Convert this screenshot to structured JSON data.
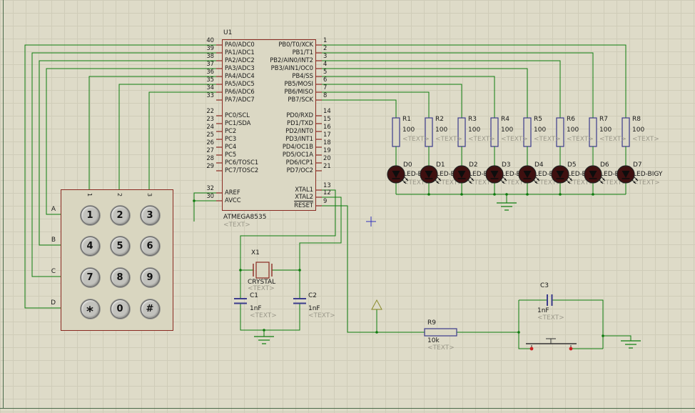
{
  "colors": {
    "background": "#dedbc8",
    "grid": "#cfccb8",
    "wire": "#0e7c0e",
    "component_outline": "#8a2a21",
    "analog_outline": "#3b3b8c",
    "component_fill": "#dbd8c4",
    "led_body": "#3f1010",
    "text_gray": "#9b988a",
    "origin_marker": "#3333bb",
    "button_dot": "#cc2222",
    "sheet_border": "#4a6a4a"
  },
  "chip": {
    "ref": "U1",
    "part": "ATMEGA8535",
    "text": "<TEXT>",
    "left_pins": [
      {
        "num": "40",
        "name": "PA0/ADC0"
      },
      {
        "num": "39",
        "name": "PA1/ADC1"
      },
      {
        "num": "38",
        "name": "PA2/ADC2"
      },
      {
        "num": "37",
        "name": "PA3/ADC3"
      },
      {
        "num": "36",
        "name": "PA4/ADC4"
      },
      {
        "num": "35",
        "name": "PA5/ADC5"
      },
      {
        "num": "34",
        "name": "PA6/ADC6"
      },
      {
        "num": "33",
        "name": "PA7/ADC7"
      },
      {
        "num": "22",
        "name": "PC0/SCL"
      },
      {
        "num": "23",
        "name": "PC1/SDA"
      },
      {
        "num": "24",
        "name": "PC2"
      },
      {
        "num": "25",
        "name": "PC3"
      },
      {
        "num": "26",
        "name": "PC4"
      },
      {
        "num": "27",
        "name": "PC5"
      },
      {
        "num": "28",
        "name": "PC6/TOSC1"
      },
      {
        "num": "29",
        "name": "PC7/TOSC2"
      },
      {
        "num": "32",
        "name": "AREF"
      },
      {
        "num": "30",
        "name": "AVCC"
      }
    ],
    "right_pins": [
      {
        "num": "1",
        "name": "PB0/T0/XCK"
      },
      {
        "num": "2",
        "name": "PB1/T1"
      },
      {
        "num": "3",
        "name": "PB2/AIN0/INT2"
      },
      {
        "num": "4",
        "name": "PB3/AIN1/OC0"
      },
      {
        "num": "5",
        "name": "PB4/SS"
      },
      {
        "num": "6",
        "name": "PB5/MOSI"
      },
      {
        "num": "7",
        "name": "PB6/MISO"
      },
      {
        "num": "8",
        "name": "PB7/SCK"
      },
      {
        "num": "14",
        "name": "PD0/RXD"
      },
      {
        "num": "15",
        "name": "PD1/TXD"
      },
      {
        "num": "16",
        "name": "PD2/INT0"
      },
      {
        "num": "17",
        "name": "PD3/INT1"
      },
      {
        "num": "18",
        "name": "PD4/OC1B"
      },
      {
        "num": "19",
        "name": "PD5/OC1A"
      },
      {
        "num": "20",
        "name": "PD6/ICP1"
      },
      {
        "num": "21",
        "name": "PD7/OC2"
      },
      {
        "num": "13",
        "name": "XTAL1"
      },
      {
        "num": "12",
        "name": "XTAL2"
      },
      {
        "num": "9",
        "name": "RESET"
      }
    ]
  },
  "keypad": {
    "keys": [
      "1",
      "2",
      "3",
      "4",
      "5",
      "6",
      "7",
      "8",
      "9",
      "*",
      "0",
      "#"
    ],
    "row_labels": [
      "A",
      "B",
      "C",
      "D"
    ],
    "col_labels": [
      "1",
      "2",
      "3"
    ]
  },
  "resistors": [
    {
      "ref": "R1",
      "value": "100",
      "text": "<TEXT>"
    },
    {
      "ref": "R2",
      "value": "100",
      "text": "<TEXT>"
    },
    {
      "ref": "R3",
      "value": "100",
      "text": "<TEXT>"
    },
    {
      "ref": "R4",
      "value": "100",
      "text": "<TEXT>"
    },
    {
      "ref": "R5",
      "value": "100",
      "text": "<TEXT>"
    },
    {
      "ref": "R6",
      "value": "100",
      "text": "<TEXT>"
    },
    {
      "ref": "R7",
      "value": "100",
      "text": "<TEXT>"
    },
    {
      "ref": "R8",
      "value": "100",
      "text": "<TEXT>"
    }
  ],
  "r9": {
    "ref": "R9",
    "value": "10k",
    "text": "<TEXT>"
  },
  "leds": [
    {
      "ref": "D0",
      "model": "LED-BIGY",
      "text": "<TEXT>"
    },
    {
      "ref": "D1",
      "model": "LED-BIGY",
      "text": "<TEXT>"
    },
    {
      "ref": "D2",
      "model": "LED-BIGY",
      "text": "<TEXT>"
    },
    {
      "ref": "D3",
      "model": "LED-BIGY",
      "text": "<TEXT>"
    },
    {
      "ref": "D4",
      "model": "LED-BIGY",
      "text": "<TEXT>"
    },
    {
      "ref": "D5",
      "model": "LED-BIGY",
      "text": "<TEXT>"
    },
    {
      "ref": "D6",
      "model": "LED-BIGY",
      "text": "<TEXT>"
    },
    {
      "ref": "D7",
      "model": "LED-BIGY",
      "text": "<TEXT>"
    }
  ],
  "crystal": {
    "ref": "X1",
    "value": "CRYSTAL",
    "text": "<TEXT>"
  },
  "caps": [
    {
      "ref": "C1",
      "value": "1nF",
      "text": "<TEXT>"
    },
    {
      "ref": "C2",
      "value": "1nF",
      "text": "<TEXT>"
    },
    {
      "ref": "C3",
      "value": "1nF",
      "text": "<TEXT>"
    }
  ]
}
